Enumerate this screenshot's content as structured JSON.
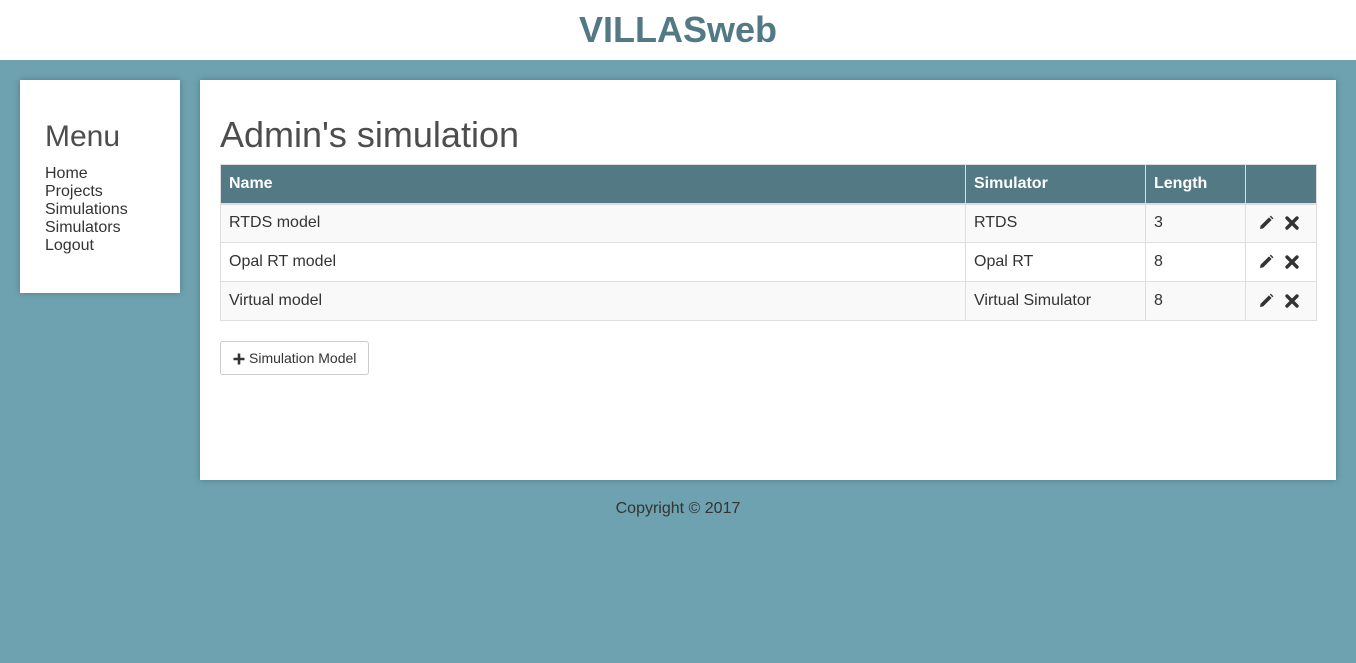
{
  "app": {
    "title": "VILLASweb"
  },
  "menu": {
    "title": "Menu",
    "items": [
      {
        "label": "Home"
      },
      {
        "label": "Projects"
      },
      {
        "label": "Simulations"
      },
      {
        "label": "Simulators"
      },
      {
        "label": "Logout"
      }
    ]
  },
  "page": {
    "title": "Admin's simulation"
  },
  "table": {
    "columns": [
      "Name",
      "Simulator",
      "Length",
      ""
    ],
    "rows": [
      {
        "name": "RTDS model",
        "simulator": "RTDS",
        "length": "3"
      },
      {
        "name": "Opal RT model",
        "simulator": "Opal RT",
        "length": "8"
      },
      {
        "name": "Virtual model",
        "simulator": "Virtual Simulator",
        "length": "8"
      }
    ],
    "row_actions": [
      "edit-icon",
      "delete-icon"
    ]
  },
  "add_button": {
    "label": "Simulation Model",
    "icon": "plus-icon"
  },
  "footer": {
    "text": "Copyright © 2017"
  },
  "colors": {
    "brand": "#527984",
    "background": "#6ea2b0",
    "table_header": "#527984"
  }
}
